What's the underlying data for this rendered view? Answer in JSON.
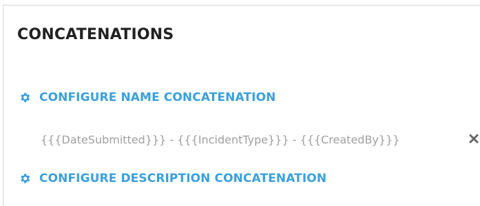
{
  "section": {
    "title": "CONCATENATIONS"
  },
  "name_concat": {
    "link_label": "CONFIGURE NAME CONCATENATION",
    "icon": "gear-icon",
    "value": "{{{DateSubmitted}}} - {{{IncidentType}}} - {{{CreatedBy}}}",
    "remove_icon": "close-icon"
  },
  "description_concat": {
    "link_label": "CONFIGURE DESCRIPTION CONCATENATION",
    "icon": "gear-icon"
  },
  "colors": {
    "accent": "#3aa0dd",
    "title": "#222222",
    "muted_text": "#a0a0a0",
    "remove_icon": "#666666"
  }
}
